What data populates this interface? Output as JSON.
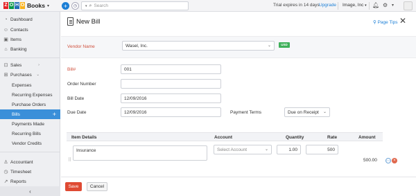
{
  "brand": {
    "logo_letters": [
      "Z",
      "O",
      "H",
      "O"
    ],
    "logo_colors": [
      "#e42527",
      "#089949",
      "#226db4",
      "#f9b21d"
    ],
    "product": "Books"
  },
  "topbar": {
    "search_placeholder": "Search",
    "trial_text": "Trial expires in 14 days",
    "upgrade_link": "Upgrade",
    "org_name": "Image, Inc",
    "plus_icon": "add-icon",
    "plus_color": "#1c7fd6"
  },
  "sidebar": {
    "items": [
      {
        "label": "Dashboard",
        "icon": "dashboard-icon"
      },
      {
        "label": "Contacts",
        "icon": "contacts-icon"
      },
      {
        "label": "Items",
        "icon": "items-icon"
      },
      {
        "label": "Banking",
        "icon": "banking-icon"
      },
      {
        "label": "Sales",
        "icon": "sales-icon"
      },
      {
        "label": "Purchases",
        "icon": "purchases-icon"
      }
    ],
    "purchases_sub": [
      {
        "label": "Expenses"
      },
      {
        "label": "Recurring Expenses"
      },
      {
        "label": "Purchase Orders"
      },
      {
        "label": "Bills",
        "active": true
      },
      {
        "label": "Payments Made"
      },
      {
        "label": "Recurring Bills"
      },
      {
        "label": "Vendor Credits"
      }
    ],
    "bottom_items": [
      {
        "label": "Accountant",
        "icon": "accountant-icon"
      },
      {
        "label": "Timesheet",
        "icon": "timesheet-icon"
      },
      {
        "label": "Reports",
        "icon": "reports-icon"
      }
    ],
    "active_color": "#3b8fd9"
  },
  "page": {
    "title": "New Bill",
    "page_tips": "Page Tips"
  },
  "form": {
    "vendor_label": "Vendor Name",
    "vendor_value": "Wasel, Inc.",
    "currency_badge": "USD",
    "bill_label": "Bill#",
    "bill_value": "001",
    "order_label": "Order Number",
    "order_value": "",
    "bill_date_label": "Bill Date",
    "bill_date_value": "12/09/2016",
    "due_date_label": "Due Date",
    "due_date_value": "12/09/2016",
    "payment_terms_label": "Payment Terms",
    "payment_terms_value": "Due on Receipt"
  },
  "items_table": {
    "headers": {
      "item": "Item Details",
      "account": "Account",
      "quantity": "Quantity",
      "rate": "Rate",
      "amount": "Amount"
    },
    "rows": [
      {
        "item": "Insurance",
        "account_placeholder": "Select Account",
        "quantity": "1.00",
        "rate": "500",
        "amount": "500.00"
      }
    ]
  },
  "footer": {
    "save": "Save",
    "cancel": "Cancel",
    "save_color": "#df4a33"
  }
}
